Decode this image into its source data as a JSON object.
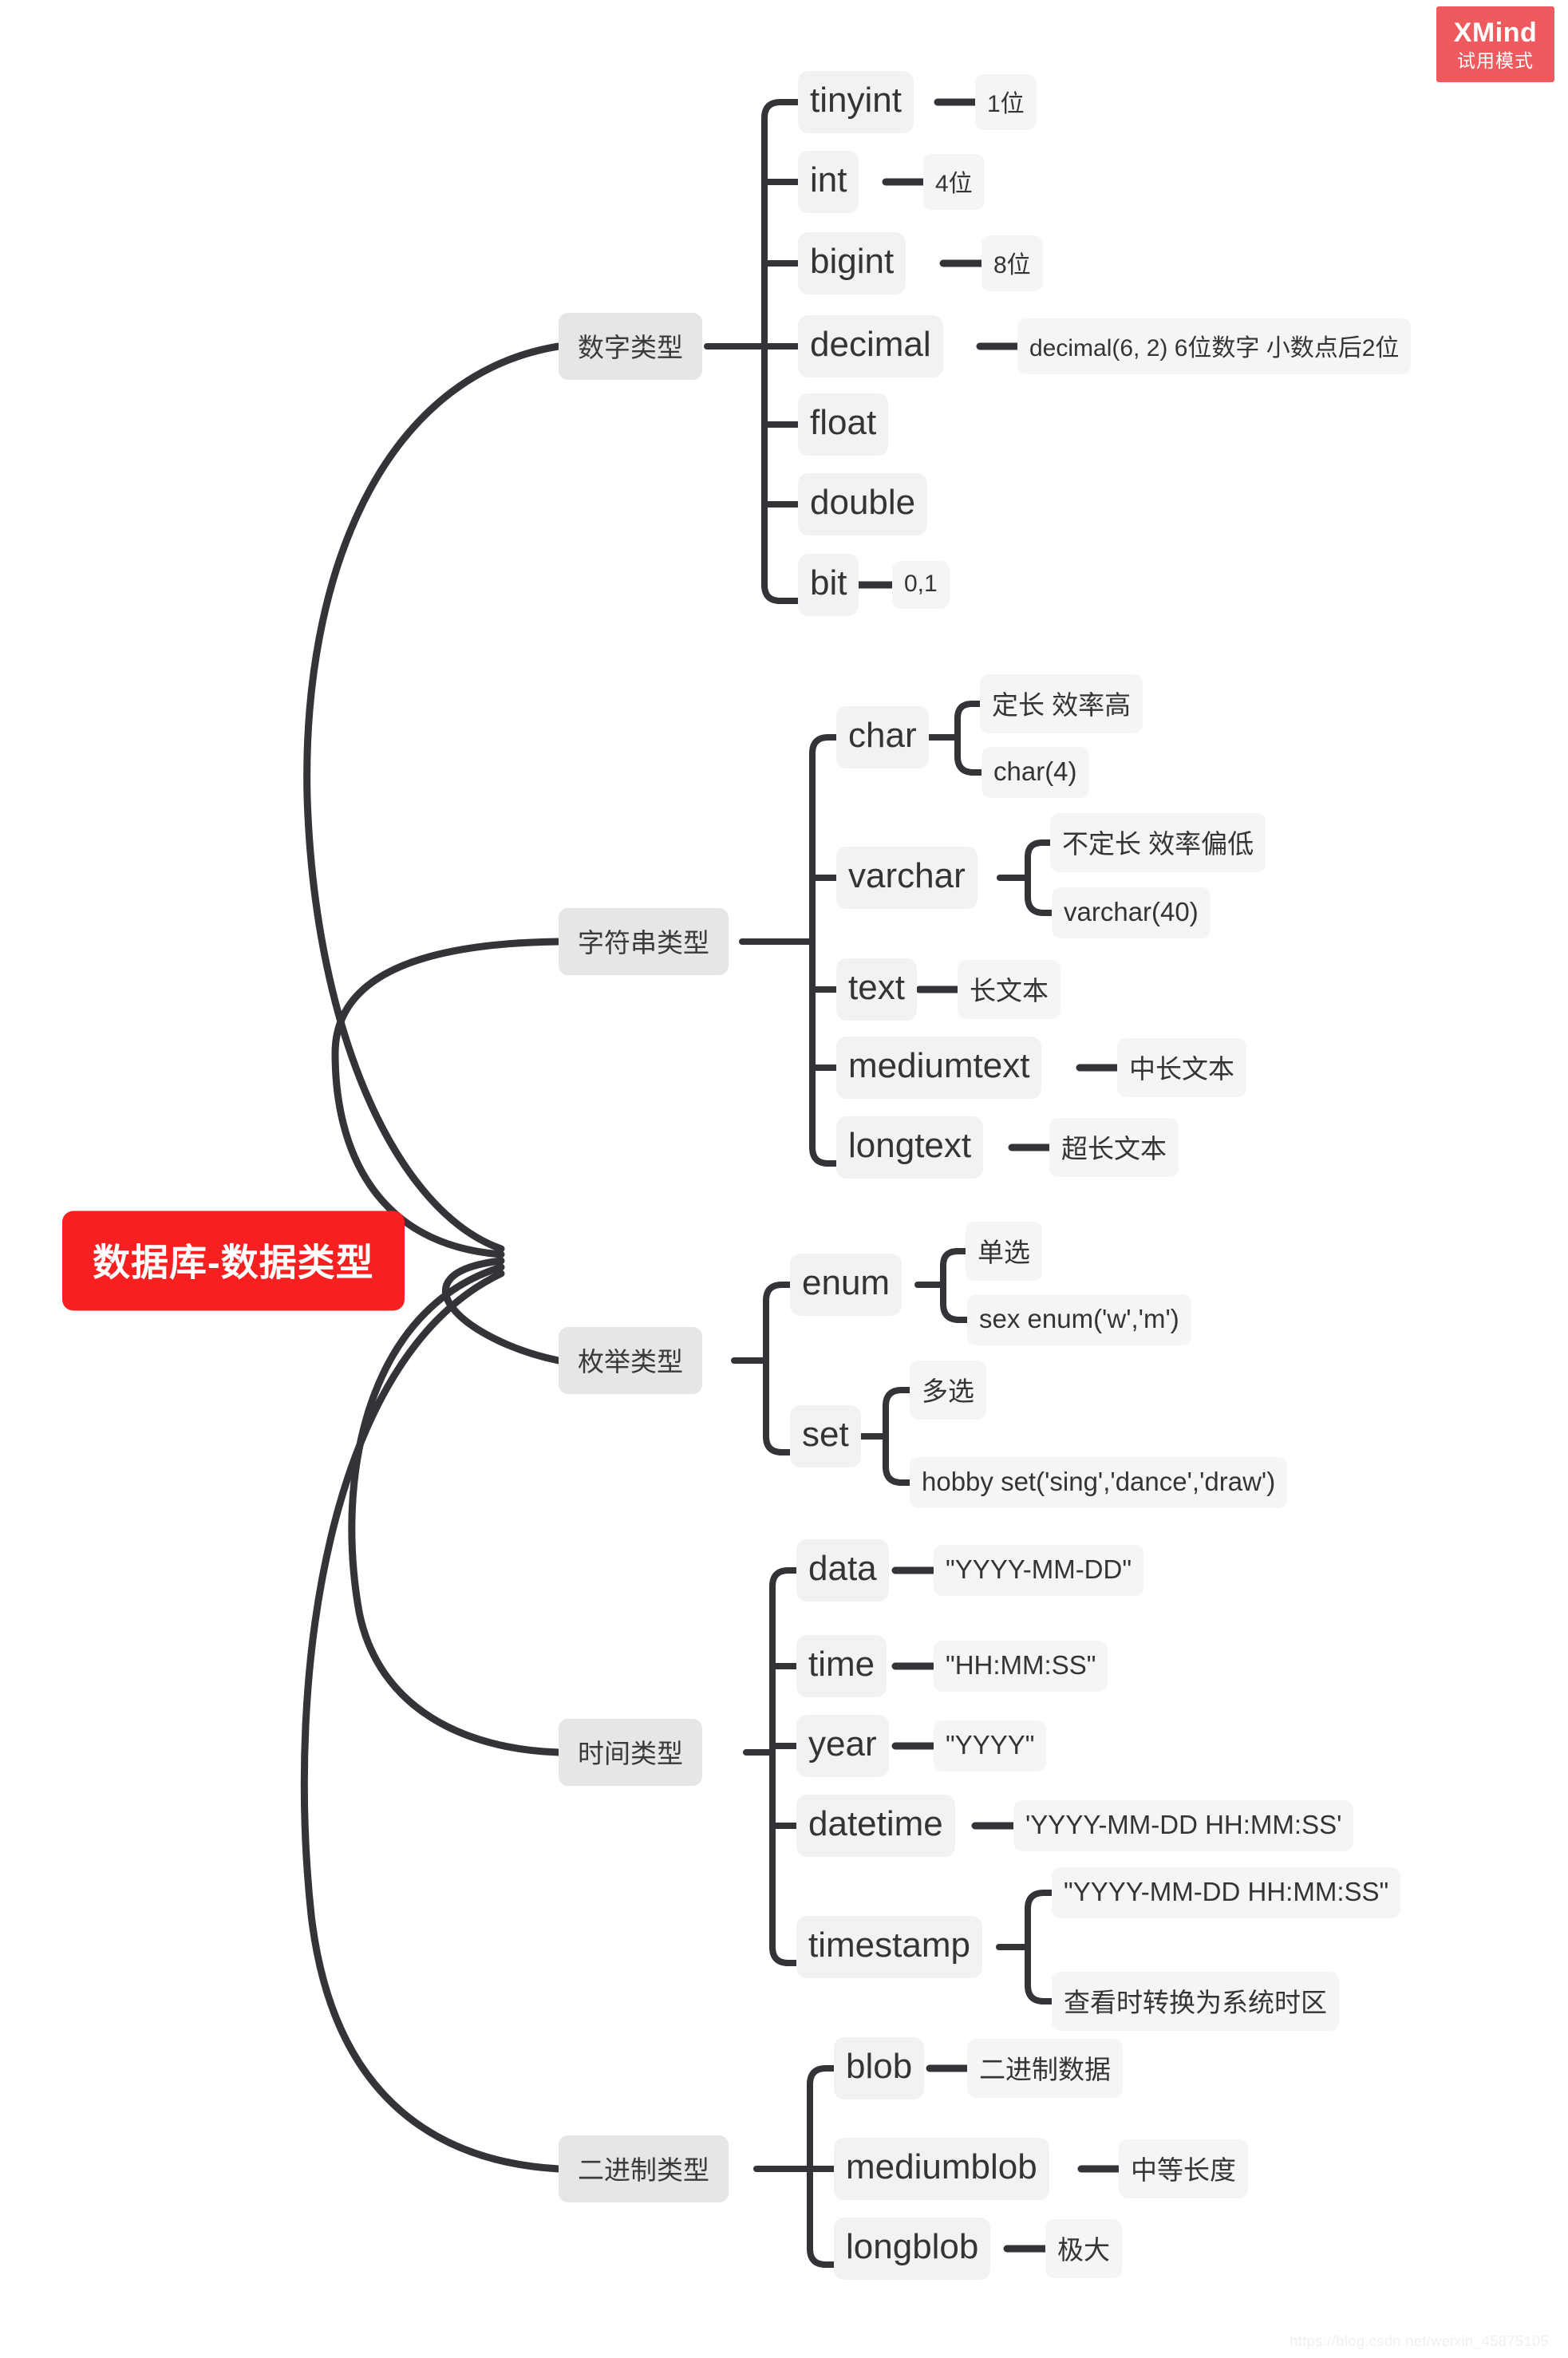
{
  "watermark": {
    "brand": "XMind",
    "mode": "试用模式",
    "footer": "https://blog.csdn.net/weixin_45875105"
  },
  "colors": {
    "root_bg": "#f72020",
    "root_text": "#ffffff",
    "category_bg": "#e6e6e6",
    "type_bg": "#f2f2f2",
    "desc_bg": "#f5f5f5",
    "link": "#333437",
    "badge_bg": "#ef5a5e"
  },
  "mindmap": {
    "type": "mindmap",
    "root": "数据库-数据类型",
    "branches": [
      {
        "label": "数字类型",
        "children": [
          {
            "name": "tinyint",
            "details": [
              "1位"
            ]
          },
          {
            "name": "int",
            "details": [
              "4位"
            ]
          },
          {
            "name": "bigint",
            "details": [
              "8位"
            ]
          },
          {
            "name": "decimal",
            "details": [
              "decimal(6, 2) 6位数字  小数点后2位"
            ]
          },
          {
            "name": "float",
            "details": []
          },
          {
            "name": "double",
            "details": []
          },
          {
            "name": "bit",
            "details": [
              "0,1"
            ]
          }
        ]
      },
      {
        "label": "字符串类型",
        "children": [
          {
            "name": "char",
            "details": [
              "定长 效率高",
              "char(4)"
            ]
          },
          {
            "name": "varchar",
            "details": [
              "不定长 效率偏低",
              "varchar(40)"
            ]
          },
          {
            "name": "text",
            "details": [
              "长文本"
            ]
          },
          {
            "name": "mediumtext",
            "details": [
              "中长文本"
            ]
          },
          {
            "name": "longtext",
            "details": [
              "超长文本"
            ]
          }
        ]
      },
      {
        "label": "枚举类型",
        "children": [
          {
            "name": "enum",
            "details": [
              "单选",
              "sex enum('w','m')"
            ]
          },
          {
            "name": "set",
            "details": [
              "多选",
              "hobby set('sing','dance','draw')"
            ]
          }
        ]
      },
      {
        "label": "时间类型",
        "children": [
          {
            "name": "data",
            "details": [
              "\"YYYY-MM-DD\""
            ]
          },
          {
            "name": "time",
            "details": [
              "\"HH:MM:SS\""
            ]
          },
          {
            "name": "year",
            "details": [
              "\"YYYY\""
            ]
          },
          {
            "name": "datetime",
            "details": [
              "'YYYY-MM-DD HH:MM:SS'"
            ]
          },
          {
            "name": "timestamp",
            "details": [
              "\"YYYY-MM-DD HH:MM:SS\"",
              "查看时转换为系统时区"
            ]
          }
        ]
      },
      {
        "label": "二进制类型",
        "children": [
          {
            "name": "blob",
            "details": [
              "二进制数据"
            ]
          },
          {
            "name": "mediumblob",
            "details": [
              "中等长度"
            ]
          },
          {
            "name": "longblob",
            "details": [
              "极大"
            ]
          }
        ]
      }
    ]
  }
}
